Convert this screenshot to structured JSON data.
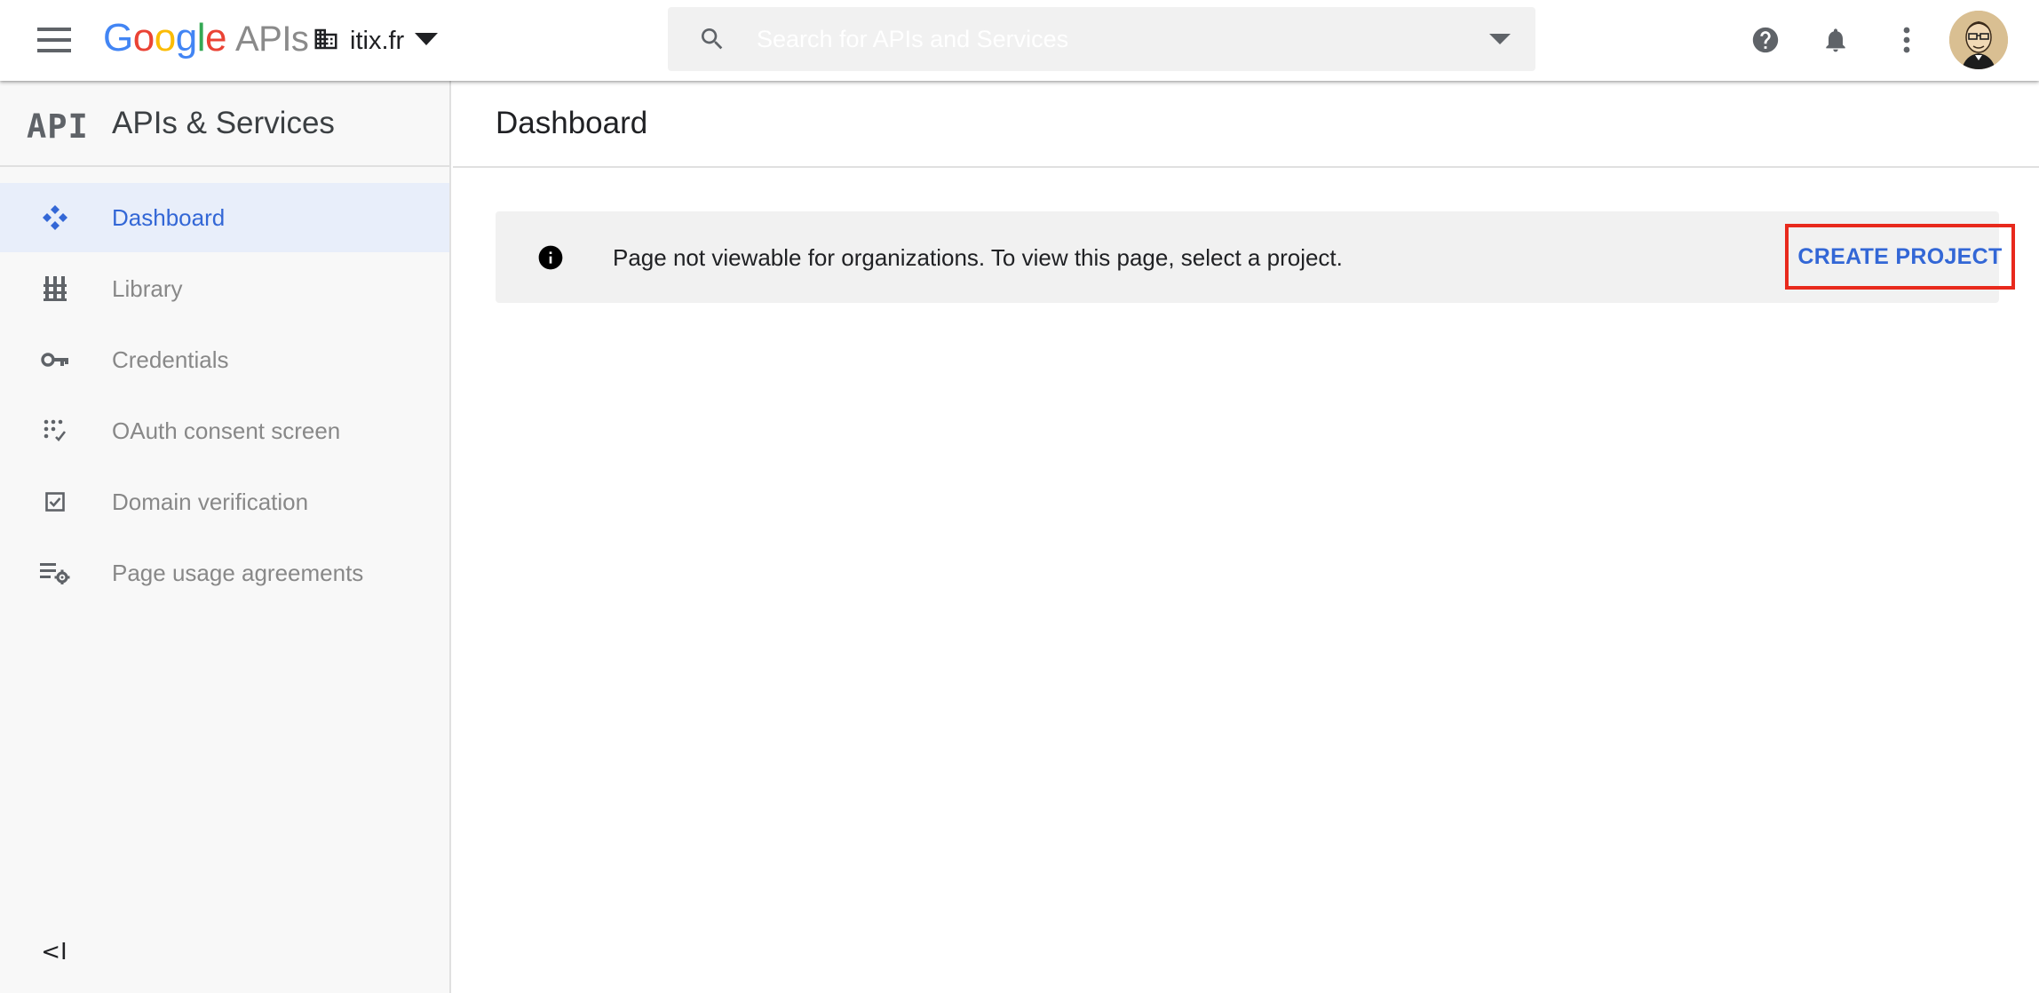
{
  "topbar": {
    "logo": {
      "google": [
        "G",
        "o",
        "o",
        "g",
        "l",
        "e"
      ],
      "suffix": "APIs"
    },
    "org_name": "itix.fr",
    "search": {
      "placeholder": "Search for APIs and Services",
      "value": ""
    },
    "icons": [
      "menu-icon",
      "building-icon",
      "dropdown-arrow-icon",
      "search-icon",
      "help-icon",
      "bell-icon",
      "more-vert-icon"
    ]
  },
  "sidebar": {
    "logo_text": "API",
    "title": "APIs & Services",
    "items": [
      {
        "label": "Dashboard",
        "icon": "dashboard-icon",
        "active": true
      },
      {
        "label": "Library",
        "icon": "library-icon",
        "active": false
      },
      {
        "label": "Credentials",
        "icon": "key-icon",
        "active": false
      },
      {
        "label": "OAuth consent screen",
        "icon": "oauth-grid-icon",
        "active": false
      },
      {
        "label": "Domain verification",
        "icon": "checkbox-icon",
        "active": false
      },
      {
        "label": "Page usage agreements",
        "icon": "list-settings-icon",
        "active": false
      }
    ],
    "collapse_glyph": "<I"
  },
  "main": {
    "title": "Dashboard",
    "banner": {
      "message": "Page not viewable for organizations. To view this page, select a project.",
      "action_label": "CREATE PROJECT"
    }
  },
  "colors": {
    "accent": "#3367d6",
    "active_bg": "#e8eefa",
    "highlight_border": "#e8291c",
    "banner_bg": "#f1f1f1",
    "sidebar_bg": "#f8f8f8"
  }
}
